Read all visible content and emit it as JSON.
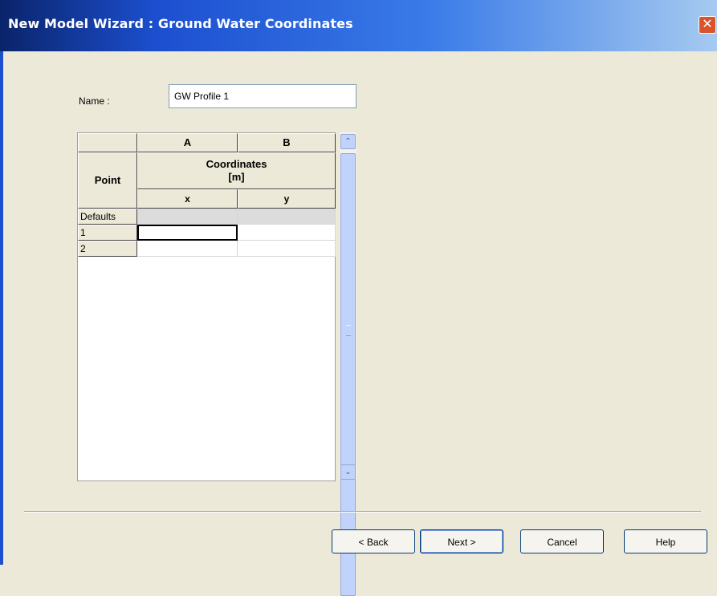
{
  "window": {
    "title": "New Model Wizard : Ground Water Coordinates",
    "close_glyph": "✕",
    "accent_color": "#1c4fd0"
  },
  "form": {
    "name_label": "Name :",
    "name_value": "GW Profile 1"
  },
  "grid": {
    "column_letters": [
      "A",
      "B"
    ],
    "point_header": "Point",
    "coordinates_header": "Coordinates",
    "unit_header": "[m]",
    "sub_headers": [
      "x",
      "y"
    ],
    "rows": [
      {
        "label": "Defaults",
        "x": "",
        "y": ""
      },
      {
        "label": "1",
        "x": "",
        "y": ""
      },
      {
        "label": "2",
        "x": "",
        "y": ""
      }
    ]
  },
  "scrollbar": {
    "up_glyph": "⌃",
    "down_glyph": "⌄"
  },
  "buttons": {
    "back": "< Back",
    "next": "Next >",
    "cancel": "Cancel",
    "help": "Help"
  }
}
